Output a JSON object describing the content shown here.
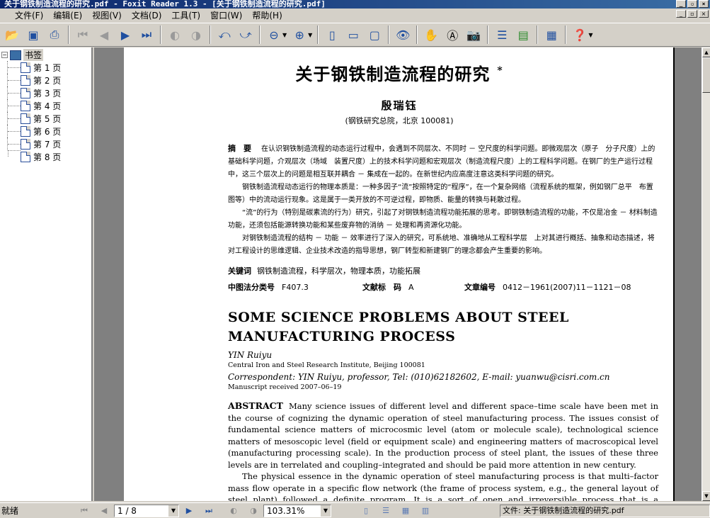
{
  "window": {
    "title": "关于钢铁制造流程的研究.pdf - Foxit Reader 1.3 - [关于钢铁制造流程的研究.pdf]",
    "controls": {
      "minimize": "_",
      "restore": "▫",
      "close": "×"
    }
  },
  "menu": [
    "文件(F)",
    "编辑(E)",
    "视图(V)",
    "文档(D)",
    "工具(T)",
    "窗口(W)",
    "帮助(H)"
  ],
  "toolbar": {
    "icons": [
      "open-icon",
      "save-icon",
      "print-icon",
      "first-page-icon",
      "prev-page-icon",
      "next-page-icon",
      "last-page-icon",
      "back-icon",
      "forward-icon",
      "rotate-left-icon",
      "rotate-right-icon",
      "zoom-out-icon",
      "zoom-in-icon",
      "actual-size-icon",
      "fit-page-icon",
      "fit-width-icon",
      "find-icon",
      "hand-tool-icon",
      "text-select-icon",
      "snapshot-icon",
      "bookmarks-panel-icon",
      "thumbnail-panel-icon",
      "properties-icon",
      "help-icon"
    ]
  },
  "bookmarks": {
    "root": "书签",
    "items": [
      "第 1 页",
      "第 2 页",
      "第 3 页",
      "第 4 页",
      "第 5 页",
      "第 6 页",
      "第 7 页",
      "第 8 页"
    ]
  },
  "document": {
    "title_cn": "关于钢铁制造流程的研究",
    "title_mark": "*",
    "author_cn": "殷瑞钰",
    "affiliation_cn": "(钢铁研究总院，北京 100081)",
    "abstract_label": "摘　要",
    "abstract_cn": [
      "在认识钢铁制造流程的动态运行过程中，会遇到不同层次、不同时 － 空尺度的科学问题。即微观层次（原子　分子尺度）上的基础科学问题，介观层次（场域　装置尺度）上的技术科学问题和宏观层次（制造流程尺度）上的工程科学问题。在钢厂的生产运行过程中，这三个层次上的问题是相互联并耦合 － 集成在一起的。在新世纪内应高度注意这类科学问题的研究。",
      "钢铁制造流程动态运行的物理本质是：一种多因子“流”按照特定的“程序”，在一个复杂网络（流程系统的框架，例如钢厂总平　布置图等）中的流动运行现象。这是属于一类开放的不可逆过程，即物质、能量的转换与耗散过程。",
      "“流”的行为（特别是碳素流的行为）研究，引起了对钢铁制造流程功能拓展的思考。即钢铁制造流程的功能，不仅是冶金 － 材料制造功能，还须包括能源转换功能和某些废弃物的消纳 － 处理和再资源化功能。",
      "对钢铁制造流程的结构 － 功能 － 效率进行了深入的研究，可系统地、准确地从工程科学层　上对其进行概括、抽象和动态描述，将对工程设计的思维逻辑、企业技术改造的指导思想，钢厂转型和新建钢厂的理念都会产生重要的影响。"
    ],
    "keywords_label": "关键词",
    "keywords_cn": "钢铁制造流程，科学层次，物理本质，功能拓展",
    "clc_label": "中图法分类号",
    "clc_value": "F407.3",
    "doc_code_label": "文献标　码",
    "doc_code_value": "A",
    "article_no_label": "文章编号",
    "article_no_value": "0412－1961(2007)11－1121－08",
    "title_en": "SOME SCIENCE PROBLEMS ABOUT STEEL MANUFACTURING PROCESS",
    "author_en": "YIN Ruiyu",
    "affiliation_en": "Central Iron and Steel Research Institute, Beijing 100081",
    "correspondent_en": "Correspondent: YIN Ruiyu, professor, Tel: (010)62182602, E-mail: yuanwu@cisri.com.cn",
    "received_en": "Manuscript received 2007–06–19",
    "abstract_label_en": "ABSTRACT",
    "abstract_en_1": "Many science issues of different level and different space–time scale have been met in the course of cognizing the dynamic operation of steel manufacturing process. The issues consist of fundamental science matters of microcosmic level (atom or molecule scale), technological science matters of mesoscopic level (field or equipment scale) and engineering matters of macroscopical level (manufacturing processing scale). In the production process of steel plant, the issues of these three levels are in terrelated and coupling–integrated and should be paid more attention in new century.",
    "abstract_en_2": "The physical essence in the dynamic operation of steel manufacturing process is that multi–factor mass flow operate in a specific flow network (the frame of process system, e.g., the general layout of steel plant) followed a definite program. It is a sort of open and irreversible process that is a conversion"
  },
  "statusbar": {
    "ready": "就绪",
    "page": "1 / 8",
    "zoom": "103.31%",
    "file": "文件: 关于钢铁制造流程的研究.pdf"
  }
}
